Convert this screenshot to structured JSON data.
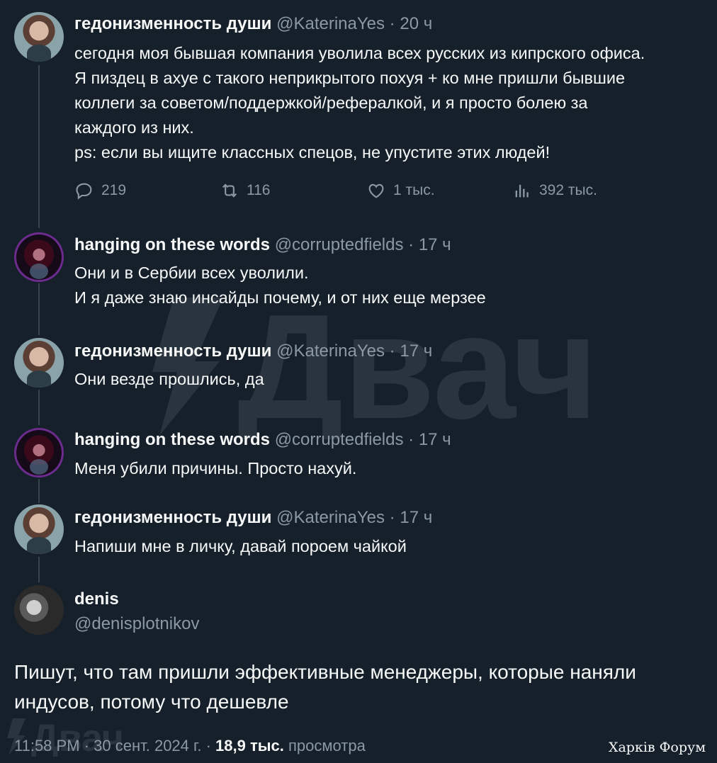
{
  "colors": {
    "background": "#15202b",
    "text": "#f7f9f9",
    "muted": "#8b98a5",
    "thread_line": "#38444d"
  },
  "watermark": {
    "text": "Двач"
  },
  "tweets": [
    {
      "name": "гедонизменность души",
      "handle": "@KaterinaYes",
      "time": "20 ч",
      "lines": [
        "сегодня моя бывшая компания уволила всех русских из кипрского офиса.",
        "Я пиздец в ахуе с такого неприкрытого похуя + ко мне пришли бывшие",
        "коллеги за советом/поддержкой/рефералкой, и я просто болею за",
        "каждого из них.",
        "ps: если вы ищите классных спецов, не упустите этих людей!"
      ],
      "actions": {
        "replies": "219",
        "retweets": "116",
        "likes": "1 тыс.",
        "views": "392 тыс."
      }
    },
    {
      "name": "hanging on these words",
      "handle": "@corruptedfields",
      "time": "17 ч",
      "lines": [
        "Они и в Сербии всех уволили.",
        "И я даже знаю инсайды почему, и от них еще мерзее"
      ]
    },
    {
      "name": "гедонизменность души",
      "handle": "@KaterinaYes",
      "time": "17 ч",
      "lines": [
        "Они везде прошлись, да"
      ]
    },
    {
      "name": "hanging on these words",
      "handle": "@corruptedfields",
      "time": "17 ч",
      "lines": [
        "Меня убили причины. Просто нахуй."
      ]
    },
    {
      "name": "гедонизменность души",
      "handle": "@KaterinaYes",
      "time": "17 ч",
      "lines": [
        "Напиши мне в личку, давай пороем чайкой"
      ]
    }
  ],
  "main_tweet": {
    "name": "denis",
    "handle": "@denisplotnikov",
    "lines": [
      "Пишут, что там пришли эффективные менеджеры, которые наняли",
      "индусов, потому что дешевле"
    ],
    "time": "11:58 PM",
    "date": "30 сент. 2024 г.",
    "views": "18,9 тыс.",
    "views_label": "просмотра"
  },
  "forum_label": "Харків Форум",
  "separator": "·"
}
